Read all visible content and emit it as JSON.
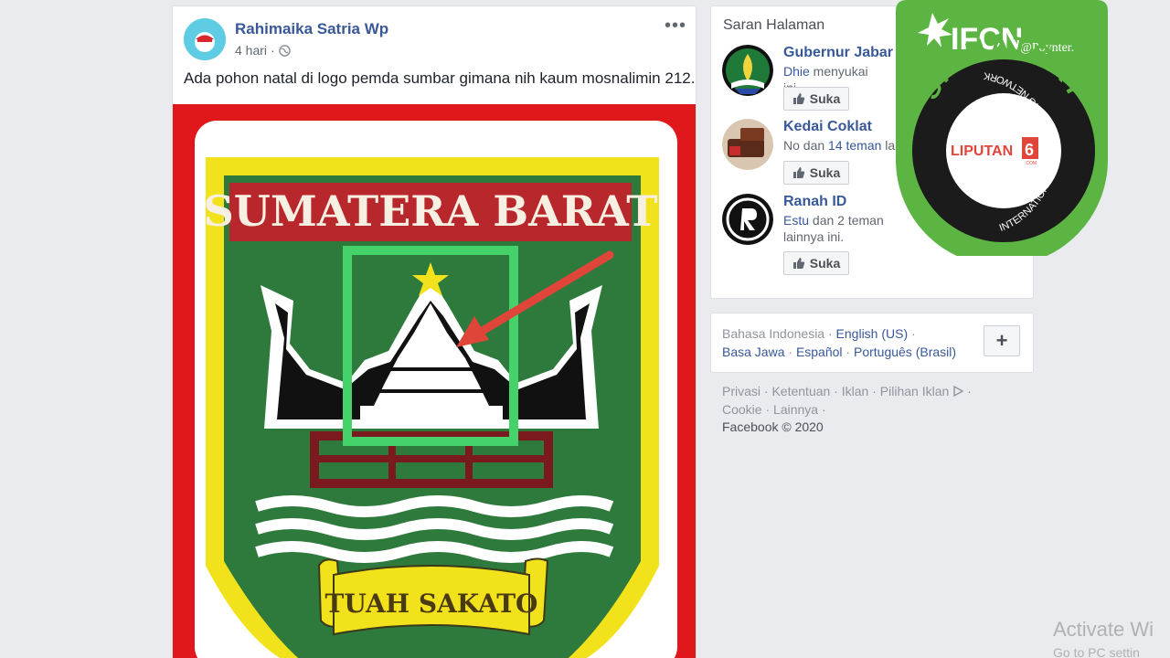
{
  "post": {
    "author": "Rahimaika Satria Wp",
    "time": "4 hari",
    "separator": "·",
    "more": "•••",
    "text": "Ada pohon natal di logo pemda sumbar gimana nih kaum mosnalimin 212.",
    "image": {
      "banner": "SUMATERA BARAT",
      "motto": "TUAH SAKATO",
      "colors": {
        "frame": "#e0181b",
        "yellow": "#f2e21c",
        "green": "#2e7a3d",
        "banner": "#b8272b",
        "highlight": "#45d26a",
        "arrow": "#e0453a"
      }
    }
  },
  "sidebar": {
    "title": "Saran Halaman",
    "pages": [
      {
        "name": "Gubernur Jabar",
        "sub_before": "",
        "sub_link": "Dhie",
        "sub_after": " menyukai ini.",
        "like": "Suka",
        "icon": "west-java-emblem-icon"
      },
      {
        "name": "Kedai Coklat",
        "sub_before": "No dan ",
        "sub_link": "14 teman",
        "sub_after": " la",
        "like": "Suka",
        "icon": "chocolate-icon"
      },
      {
        "name": "Ranah ID",
        "sub_before": "",
        "sub_link": "Estu",
        "sub_after": " dan 2 teman lainnya ini.",
        "like": "Suka",
        "icon": "ranah-logo-icon"
      }
    ]
  },
  "languages": {
    "line1": [
      "Bahasa Indonesia",
      "English (US)"
    ],
    "line2": [
      "Basa Jawa",
      "Español",
      "Português (Brasil)"
    ],
    "plus": "+"
  },
  "footer": {
    "line1": [
      "Privasi",
      "Ketentuan",
      "Iklan",
      "Pilihan Iklan"
    ],
    "line2": [
      "Cookie",
      "Lainnya"
    ],
    "copyright": "Facebook © 2020"
  },
  "badge": {
    "ifcn": "IFCN",
    "poynter": "@Poynter.",
    "signatory": "SIGNATORY",
    "network": "INTERNATIONAL FACT-CHECKING NETWORK",
    "liputan": "LIPUTAN",
    "six": "6",
    "com": ".COM",
    "green": "#5cb543"
  },
  "watermark": {
    "line1": "Activate Wi",
    "line2": "Go to PC settin"
  }
}
